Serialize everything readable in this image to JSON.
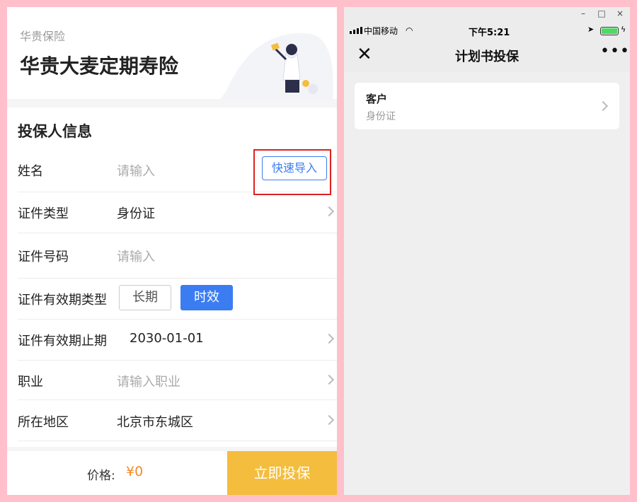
{
  "left": {
    "header": {
      "company": "华贵保险",
      "product": "华贵大麦定期寿险"
    },
    "section_title": "投保人信息",
    "fields": {
      "name": {
        "label": "姓名",
        "placeholder": "请输入",
        "action": "快速导入"
      },
      "id_type": {
        "label": "证件类型",
        "value": "身份证"
      },
      "id_number": {
        "label": "证件号码",
        "placeholder": "请输入"
      },
      "validity_type": {
        "label": "证件有效期类型",
        "options": [
          "长期",
          "时效"
        ],
        "selected": "时效"
      },
      "validity_end": {
        "label": "证件有效期止期",
        "value": "2030-01-01"
      },
      "occupation": {
        "label": "职业",
        "placeholder": "请输入职业"
      },
      "region": {
        "label": "所在地区",
        "value": "北京市东城区"
      }
    },
    "footer": {
      "price_label": "价格:",
      "price_value": "¥0",
      "buy_label": "立即投保"
    }
  },
  "right": {
    "window_controls": [
      "–",
      "□",
      "×"
    ],
    "status_bar": {
      "carrier": "中国移动",
      "time": "下午5:21"
    },
    "navbar": {
      "title": "计划书投保"
    },
    "card": {
      "title": "客户",
      "subtitle": "身份证"
    }
  },
  "colors": {
    "accent_blue": "#3b7df1",
    "buy_yellow": "#f4bd3e",
    "price_orange": "#f28c28",
    "highlight_red": "#e02020",
    "frame_pink": "#ffc0cb"
  }
}
